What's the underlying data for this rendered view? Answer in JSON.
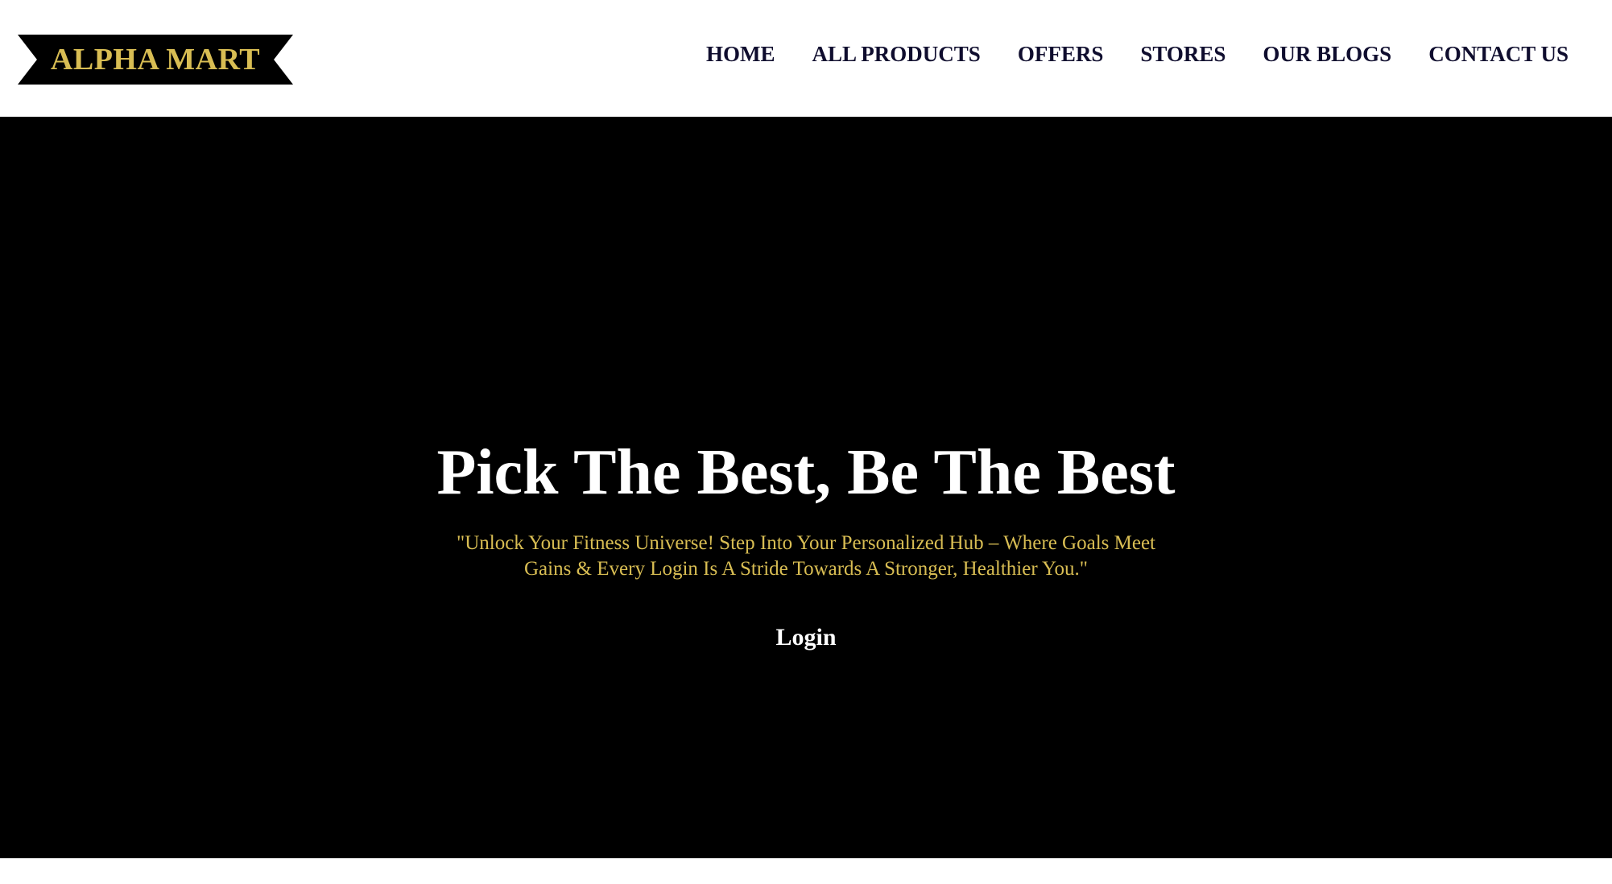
{
  "brand": {
    "name": "ALPHA MART",
    "text_color": "#d8bd53",
    "badge_color": "#000000"
  },
  "nav": {
    "links": [
      "HOME",
      "ALL PRODUCTS",
      "OFFERS",
      "STORES",
      "OUR BLOGS",
      "CONTACT US"
    ],
    "link_color": "#0f0d2e"
  },
  "hero": {
    "background": "#000000",
    "title": "Pick The Best, Be The Best",
    "subtitle": "\"Unlock Your Fitness Universe! Step Into Your Personalized Hub – Where Goals Meet Gains & Every Login Is A Stride Towards A Stronger, Healthier You.\"",
    "subtitle_color": "#d8bd53",
    "login_label": "Login"
  }
}
